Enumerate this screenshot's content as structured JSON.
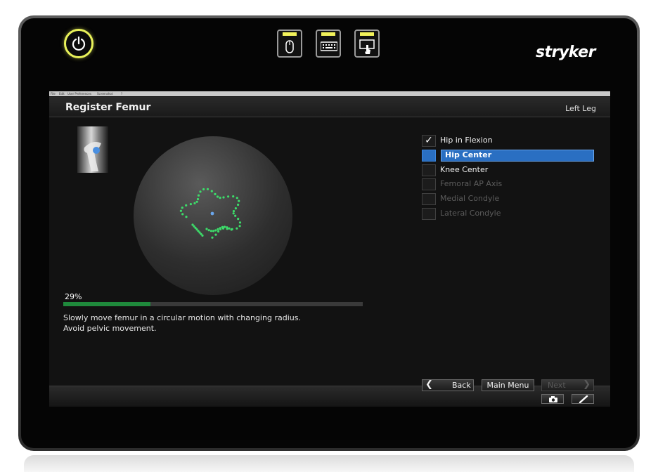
{
  "menubar": {
    "items": [
      "File",
      "Edit",
      "User Preferences",
      "Screenshot",
      "?"
    ]
  },
  "icons": {
    "power": "power-icon",
    "mouse_mode": "mouse-icon",
    "keyboard_mode": "keyboard-icon",
    "touch_mode": "touchscreen-icon",
    "camera": "camera-icon",
    "pen": "pen-icon"
  },
  "brand": {
    "logo": "stryker"
  },
  "header": {
    "title": "Register Femur",
    "side": "Left Leg"
  },
  "registration": {
    "progress_percent": 29,
    "progress_label": "29%",
    "instructions": [
      "Slowly move femur in a circular motion with changing radius.",
      "Avoid pelvic movement."
    ]
  },
  "steps": [
    {
      "label": "Hip in Flexion",
      "state": "done"
    },
    {
      "label": "Hip Center",
      "state": "active"
    },
    {
      "label": "Knee Center",
      "state": "pending"
    },
    {
      "label": "Femoral AP Axis",
      "state": "disabled"
    },
    {
      "label": "Medial Condyle",
      "state": "disabled"
    },
    {
      "label": "Lateral Condyle",
      "state": "disabled"
    }
  ],
  "nav": {
    "back": "Back",
    "main_menu": "Main Menu",
    "next": "Next"
  },
  "colors": {
    "indicator_yellow": "#f2f25a",
    "selection_blue": "#2a6fc2",
    "progress_green": "#1f8a3c",
    "point_green": "#3ddc6a",
    "center_blue": "#6aa6ec"
  }
}
